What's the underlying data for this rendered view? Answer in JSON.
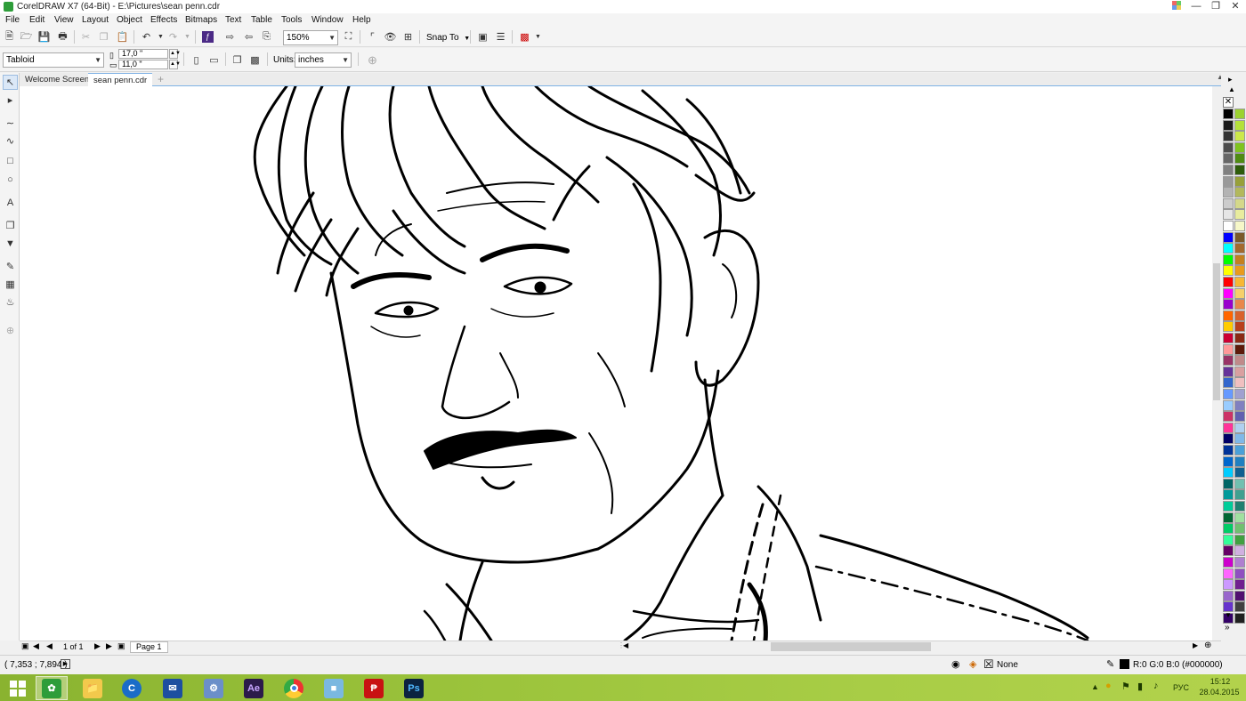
{
  "titlebar": {
    "title": "CorelDRAW X7 (64-Bit) - E:\\Pictures\\sean penn.cdr"
  },
  "menu": [
    "File",
    "Edit",
    "View",
    "Layout",
    "Object",
    "Effects",
    "Bitmaps",
    "Text",
    "Table",
    "Tools",
    "Window",
    "Help"
  ],
  "toolbar": {
    "zoom": "150%",
    "snap_to": "Snap To"
  },
  "propbar": {
    "page_size": "Tabloid",
    "width": "17,0 \"",
    "height": "11,0 \"",
    "units_label": "Units:",
    "units_value": "inches"
  },
  "tabs": [
    "Welcome Screen",
    "sean penn.cdr"
  ],
  "pagenav": {
    "page_count": "1 of 1",
    "page_tab": "Page 1"
  },
  "status": {
    "coords": "( 7,353 ; 7,894 )",
    "fill": "None",
    "outline": "R:0 G:0 B:0 (#000000)"
  },
  "tray": {
    "lang": "РУС",
    "time": "15:12",
    "date": "28.04.2015"
  },
  "colors": {
    "accent": "#7fb2e5",
    "taskbar": "#9cc43c"
  },
  "palette": [
    "#000000",
    "#1a1a1a",
    "#333333",
    "#4d4d4d",
    "#666666",
    "#808080",
    "#999999",
    "#b3b3b3",
    "#cccccc",
    "#e6e6e6",
    "#ffffff",
    "#0000ff",
    "#00ffff",
    "#00ff00",
    "#ffff00",
    "#ff0000",
    "#ff00ff",
    "#9900cc",
    "#ff6600",
    "#ffcc00",
    "#cc0033",
    "#ff9999",
    "#993366",
    "#663399",
    "#3366cc",
    "#6699ff",
    "#99ccff",
    "#cc3366",
    "#ff3399",
    "#000066",
    "#003399",
    "#0066cc",
    "#00ccff",
    "#006666",
    "#009999",
    "#00cc99",
    "#006633",
    "#00cc66",
    "#33ff99",
    "#660066",
    "#cc00cc",
    "#ff66ff",
    "#cc99ff",
    "#9966cc",
    "#6633cc",
    "#330066"
  ],
  "palette2": [
    "#9bd230",
    "#b4e13a",
    "#cce84a",
    "#7fc41f",
    "#4f8c12",
    "#2e5c0a",
    "#97a03a",
    "#b2b85c",
    "#d4d88a",
    "#e8ec9e",
    "#f6f7c8",
    "#7a5a2b",
    "#a3692e",
    "#c4801f",
    "#e89b1d",
    "#f7b733",
    "#f5d06a",
    "#e8874a",
    "#d9622b",
    "#b8401c",
    "#8a2a14",
    "#5c1a0a",
    "#c08a8a",
    "#d9a0a0",
    "#f0c0c0",
    "#a0a0d0",
    "#8080c0",
    "#6060b0",
    "#b0d0f0",
    "#80b8e8",
    "#4aa0d8",
    "#2080c0",
    "#106090",
    "#70c0b0",
    "#40a090",
    "#208070",
    "#a0e0a0",
    "#70c070",
    "#40a040",
    "#d0b0e0",
    "#b080d0",
    "#9050c0",
    "#702090",
    "#501070",
    "#404040",
    "#202020"
  ]
}
